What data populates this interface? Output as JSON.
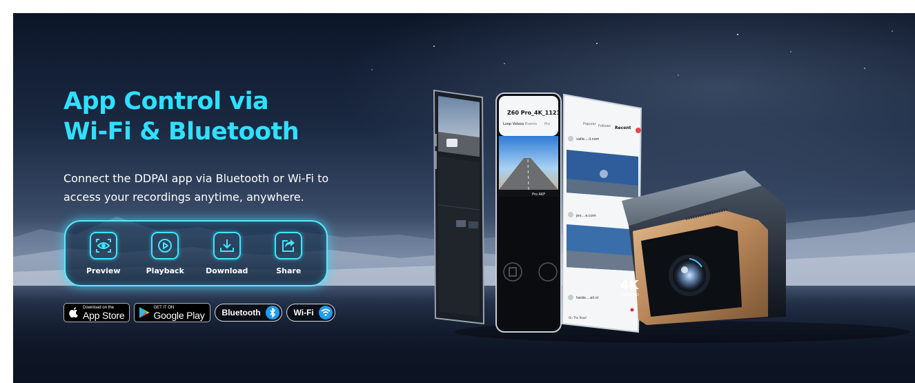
{
  "hero": {
    "title_line1": "App Control via",
    "title_line2": "Wi-Fi & Bluetooth",
    "description_line1": "Connect the DDPAI app via Bluetooth or Wi-Fi to",
    "description_line2": "access your recordings anytime, anywhere."
  },
  "features": [
    {
      "label": "Preview",
      "icon": "eye-icon"
    },
    {
      "label": "Playback",
      "icon": "play-icon"
    },
    {
      "label": "Download",
      "icon": "download-icon"
    },
    {
      "label": "Share",
      "icon": "share-icon"
    }
  ],
  "badges": {
    "app_store": {
      "small": "Download on the",
      "big": "App Store"
    },
    "google_play": {
      "small": "GET IT ON",
      "big": "Google Play"
    },
    "bluetooth": "Bluetooth",
    "wifi": "Wi-Fi"
  },
  "phones": {
    "phone2_title": "Z60 Pro_4K_1121",
    "phone2_tabs": [
      "Loop Videos",
      "Events",
      "Pro"
    ],
    "phone2_overlay": "Pro AKF",
    "phone3_tabs": [
      "Popular",
      "Follows",
      "Recent"
    ],
    "phone3_user1": "valle....il.com",
    "phone3_user2": "jev....e.com",
    "phone3_user3": "heido....ail.nl",
    "phone3_nav": [
      "On The Road"
    ]
  },
  "device": {
    "resolution": "4K",
    "resolution_sub": "ULTRA HD"
  },
  "colors": {
    "accent": "#2fe0ff",
    "bluetooth": "#1e9cf0",
    "device_gold": "#b8875a"
  }
}
